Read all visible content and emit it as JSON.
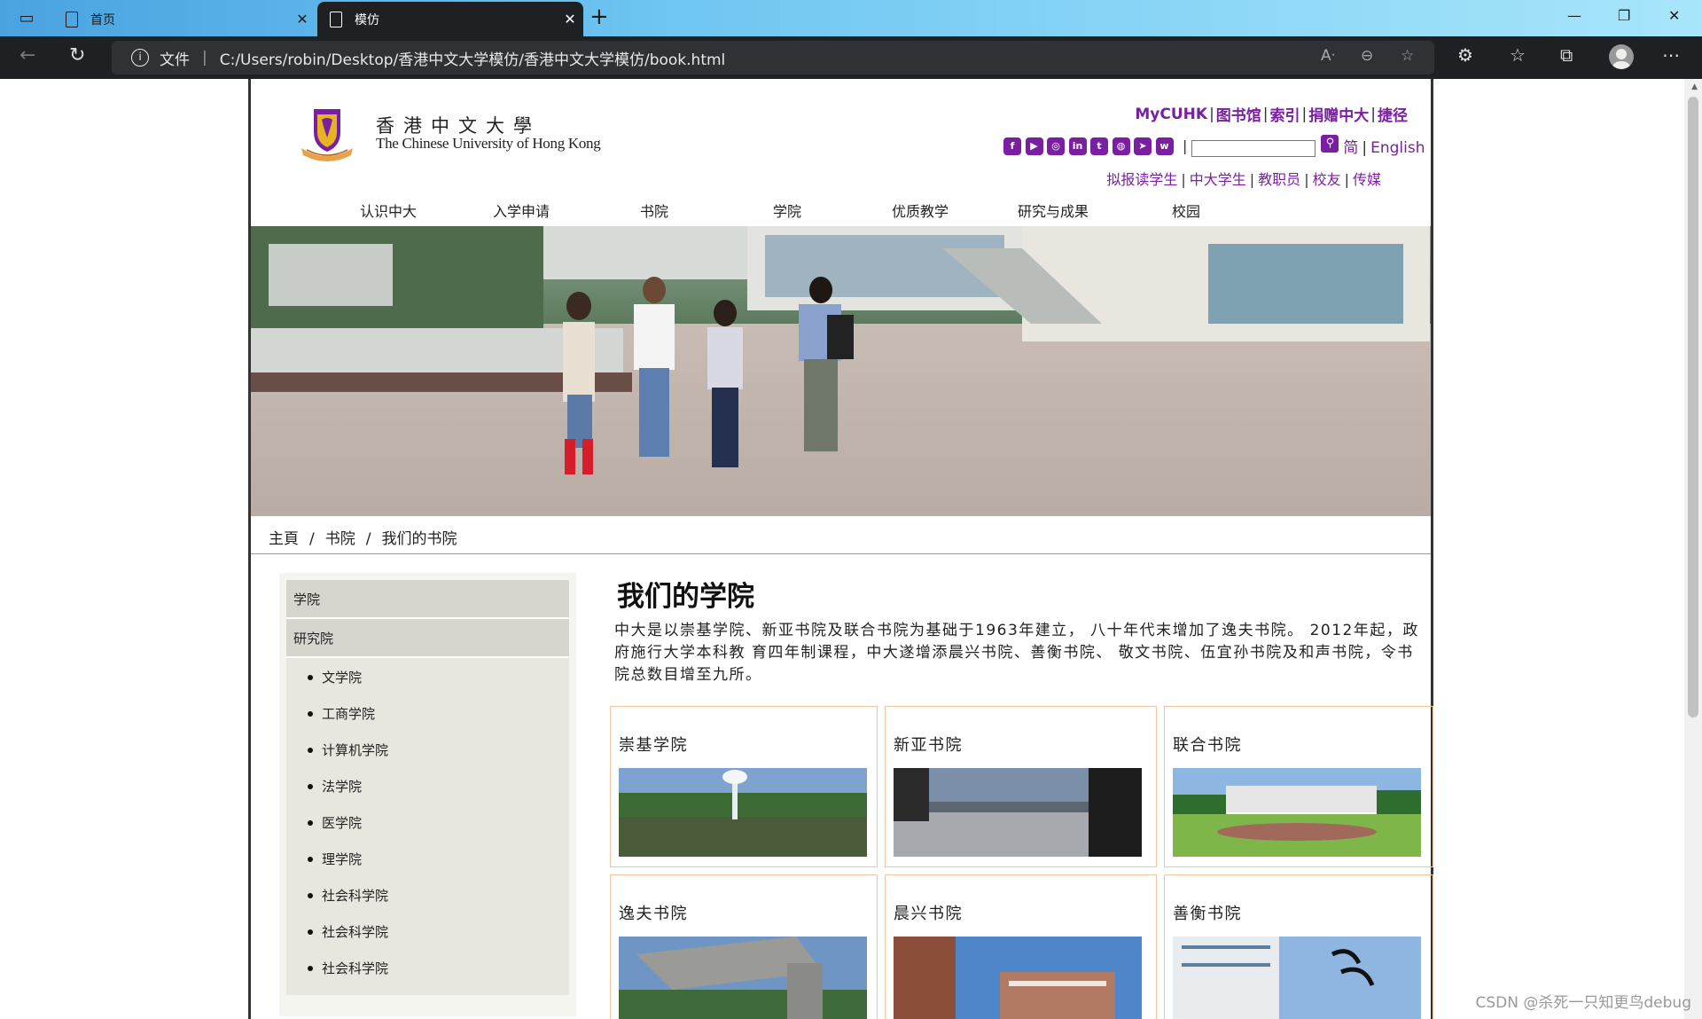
{
  "browser": {
    "tabs": [
      {
        "label": "首页",
        "active": false
      },
      {
        "label": "模仿",
        "active": true
      }
    ],
    "address": {
      "security_label": "文件",
      "url": "C:/Users/robin/Desktop/香港中文大学模仿/香港中文大学模仿/book.html"
    }
  },
  "header": {
    "logo_name_zh": "香港中文大學",
    "logo_name_en": "The Chinese University of Hong Kong",
    "top_links": [
      "MyCUHK",
      "图书馆",
      "索引",
      "捐赠中大",
      "捷径"
    ],
    "social_icons": [
      "facebook-icon",
      "youtube-icon",
      "instagram-icon",
      "linkedin-icon",
      "twitter-icon",
      "wechat-icon",
      "telegram-icon",
      "weibo-icon"
    ],
    "search": {
      "value": "",
      "placeholder": ""
    },
    "lang_simplified": "简",
    "lang_english": "English",
    "audience_links": [
      "拟报读学生",
      "中大学生",
      "教职员",
      "校友",
      "传媒"
    ],
    "nav": [
      "认识中大",
      "入学申请",
      "书院",
      "学院",
      "优质教学",
      "研究与成果",
      "校园"
    ]
  },
  "breadcrumb": [
    "主頁",
    "书院",
    "我们的书院"
  ],
  "sidebar": {
    "sections": [
      "学院",
      "研究院"
    ],
    "items": [
      "文学院",
      "工商学院",
      "计算机学院",
      "法学院",
      "医学院",
      "理学院",
      "社会科学院",
      "社会科学院",
      "社会科学院"
    ]
  },
  "main": {
    "title": "我们的学院",
    "intro": "中大是以崇基学院、新亚书院及联合书院为基础于1963年建立， 八十年代末增加了逸夫书院。 2012年起，政府施行大学本科教 育四年制课程，中大遂增添晨兴书院、善衡书院、 敬文书院、伍宜孙书院及和声书院，令书院总数目增至九所。",
    "colleges": [
      "崇基学院",
      "新亚书院",
      "联合书院",
      "逸夫书院",
      "晨兴书院",
      "善衡书院"
    ]
  },
  "watermark": "CSDN @杀死一只知更鸟debug",
  "colors": {
    "accent": "#7b1fa2",
    "card_border": "#f2c4a2",
    "tab_active": "#1f2023"
  }
}
